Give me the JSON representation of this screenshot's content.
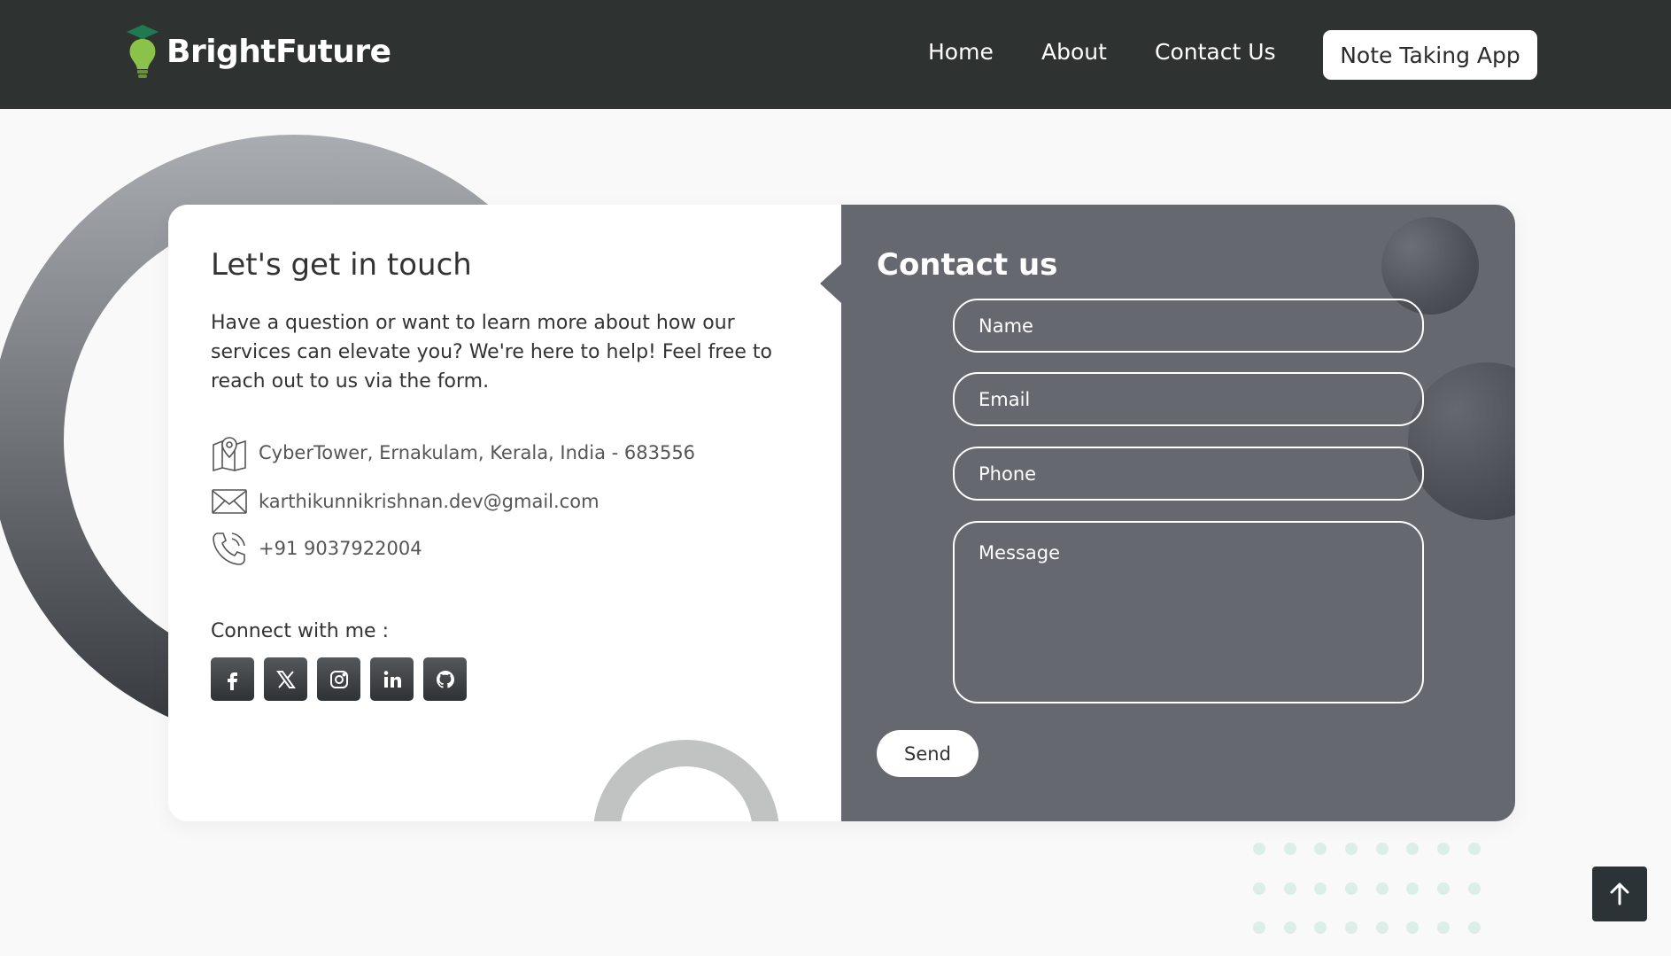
{
  "header": {
    "brand": "BrightFuture",
    "nav": {
      "home": "Home",
      "about": "About",
      "contact": "Contact Us",
      "cta": "Note Taking App"
    }
  },
  "contact_info": {
    "title": "Let's get in touch",
    "intro": "Have a question or want to learn more about how our services can elevate you? We're here to help! Feel free to reach out to us via the form.",
    "address": "CyberTower, Ernakulam, Kerala, India - 683556",
    "email": "karthikunnikrishnan.dev@gmail.com",
    "phone": "+91 9037922004",
    "connect_label": "Connect with me :",
    "socials": [
      "facebook-icon",
      "x-icon",
      "instagram-icon",
      "linkedin-icon",
      "github-icon"
    ]
  },
  "form": {
    "title": "Contact us",
    "name_placeholder": "Name",
    "email_placeholder": "Email",
    "phone_placeholder": "Phone",
    "message_placeholder": "Message",
    "send_label": "Send"
  },
  "colors": {
    "header_bg": "#2e3332",
    "form_panel": "#65686f",
    "brand_bulb": "#8bc34a",
    "dots": "#dbeee8"
  }
}
